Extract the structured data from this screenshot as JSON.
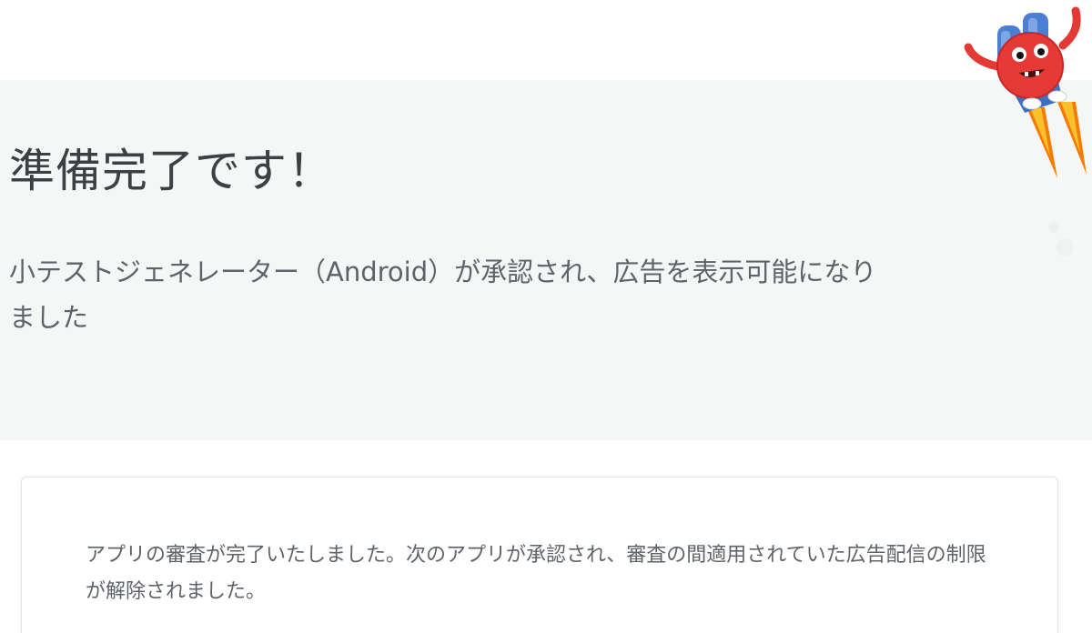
{
  "hero": {
    "title": "準備完了です！",
    "subtitle": "小テストジェネレーター（Android）が承認され、広告を表示可能になりました",
    "background_color": "#f5f6f6"
  },
  "mascot": {
    "icon": "jetpack-monster-mascot-icon",
    "colors": {
      "body": "#e53935",
      "jetpack": "#4a7fd4",
      "flame": "#f9a825"
    }
  },
  "card": {
    "message": "アプリの審査が完了いたしました。次のアプリが承認され、審査の間適用されていた広告配信の制限が解除されました。"
  }
}
